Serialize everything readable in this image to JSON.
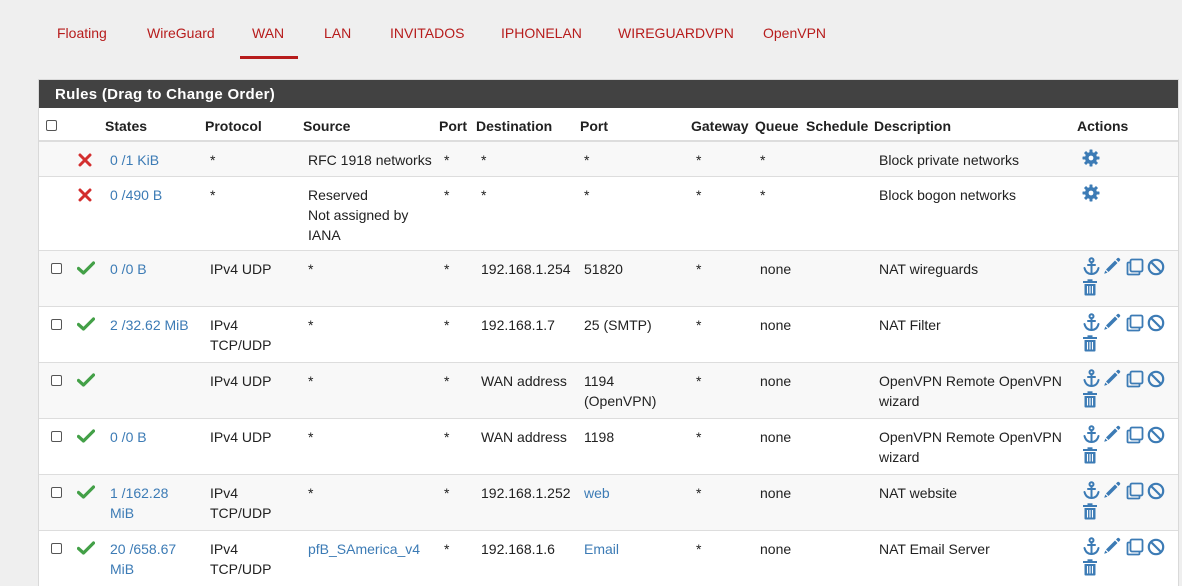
{
  "tabs": [
    {
      "label": "Floating",
      "active": false
    },
    {
      "label": "WireGuard",
      "active": false
    },
    {
      "label": "WAN",
      "active": true
    },
    {
      "label": "LAN",
      "active": false
    },
    {
      "label": "INVITADOS",
      "active": false
    },
    {
      "label": "IPHONELAN",
      "active": false
    },
    {
      "label": "WIREGUARDVPN",
      "active": false
    },
    {
      "label": "OpenVPN",
      "active": false
    }
  ],
  "panel": {
    "title": "Rules (Drag to Change Order)"
  },
  "columns": {
    "states": "States",
    "protocol": "Protocol",
    "source": "Source",
    "port": "Port",
    "destination": "Destination",
    "dport": "Port",
    "gateway": "Gateway",
    "queue": "Queue",
    "schedule": "Schedule",
    "description": "Description",
    "actions": "Actions"
  },
  "rules": [
    {
      "status": "block",
      "states1": "0 /1 KiB",
      "states2": "",
      "proto1": "*",
      "proto2": "",
      "src1": "RFC 1918 networks",
      "src2": "",
      "src3": "",
      "sport": "*",
      "dest": "*",
      "dport1": "*",
      "dport2": "",
      "dport_link": false,
      "gateway": "*",
      "queue": "*",
      "schedule": "",
      "desc1": "Block private networks",
      "desc2": ""
    },
    {
      "status": "block",
      "states1": "0 /490 B",
      "states2": "",
      "proto1": "*",
      "proto2": "",
      "src1": "Reserved",
      "src2": "Not assigned by",
      "src3": "IANA",
      "sport": "*",
      "dest": "*",
      "dport1": "*",
      "dport2": "",
      "dport_link": false,
      "gateway": "*",
      "queue": "*",
      "schedule": "",
      "desc1": "Block bogon networks",
      "desc2": ""
    },
    {
      "status": "pass",
      "states1": "0 /0 B",
      "states2": "",
      "proto1": "IPv4 UDP",
      "proto2": "",
      "src1": "*",
      "src2": "",
      "src3": "",
      "sport": "*",
      "dest": "192.168.1.254",
      "dport1": "51820",
      "dport2": "",
      "dport_link": false,
      "gateway": "*",
      "queue": "none",
      "schedule": "",
      "desc1": "NAT wireguards",
      "desc2": ""
    },
    {
      "status": "pass",
      "states1": "2 /32.62 MiB",
      "states2": "",
      "proto1": "IPv4",
      "proto2": "TCP/UDP",
      "src1": "*",
      "src2": "",
      "src3": "",
      "sport": "*",
      "dest": "192.168.1.7",
      "dport1": "25 (SMTP)",
      "dport2": "",
      "dport_link": false,
      "gateway": "*",
      "queue": "none",
      "schedule": "",
      "desc1": "NAT Filter",
      "desc2": ""
    },
    {
      "status": "pass",
      "states1": "",
      "states2": "",
      "proto1": "IPv4 UDP",
      "proto2": "",
      "src1": "*",
      "src2": "",
      "src3": "",
      "sport": "*",
      "dest": "WAN address",
      "dport1": "1194",
      "dport2": "(OpenVPN)",
      "dport_link": false,
      "gateway": "*",
      "queue": "none",
      "schedule": "",
      "desc1": "OpenVPN Remote OpenVPN",
      "desc2": "wizard"
    },
    {
      "status": "pass",
      "states1": "0 /0 B",
      "states2": "",
      "proto1": "IPv4 UDP",
      "proto2": "",
      "src1": "*",
      "src2": "",
      "src3": "",
      "sport": "*",
      "dest": "WAN address",
      "dport1": "1198",
      "dport2": "",
      "dport_link": false,
      "gateway": "*",
      "queue": "none",
      "schedule": "",
      "desc1": "OpenVPN Remote OpenVPN",
      "desc2": "wizard"
    },
    {
      "status": "pass",
      "states1": "1 /162.28",
      "states2": "MiB",
      "proto1": "IPv4",
      "proto2": "TCP/UDP",
      "src1": "*",
      "src2": "",
      "src3": "",
      "sport": "*",
      "dest": "192.168.1.252",
      "dport1": "web",
      "dport2": "",
      "dport_link": true,
      "gateway": "*",
      "queue": "none",
      "schedule": "",
      "desc1": "NAT website",
      "desc2": ""
    },
    {
      "status": "pass",
      "states1": "20 /658.67",
      "states2": "MiB",
      "proto1": "IPv4",
      "proto2": "TCP/UDP",
      "src1": "pfB_SAmerica_v4",
      "src2": "",
      "src3": "",
      "src_link": true,
      "sport": "*",
      "dest": "192.168.1.6",
      "dport1": "Email",
      "dport2": "",
      "dport_link": true,
      "gateway": "*",
      "queue": "none",
      "schedule": "",
      "desc1": "NAT Email Server",
      "desc2": ""
    }
  ],
  "colors": {
    "accent": "#b71c1c",
    "link": "#3c7bb5",
    "pass": "#43a047",
    "block": "#d32f2f",
    "header_bg": "#424242"
  },
  "icons": {
    "pass": "check-icon",
    "block": "x-icon",
    "actions": [
      "anchor-icon",
      "pencil-icon",
      "copy-icon",
      "ban-icon",
      "trash-icon"
    ],
    "default_actions": [
      "gear-icon"
    ]
  }
}
